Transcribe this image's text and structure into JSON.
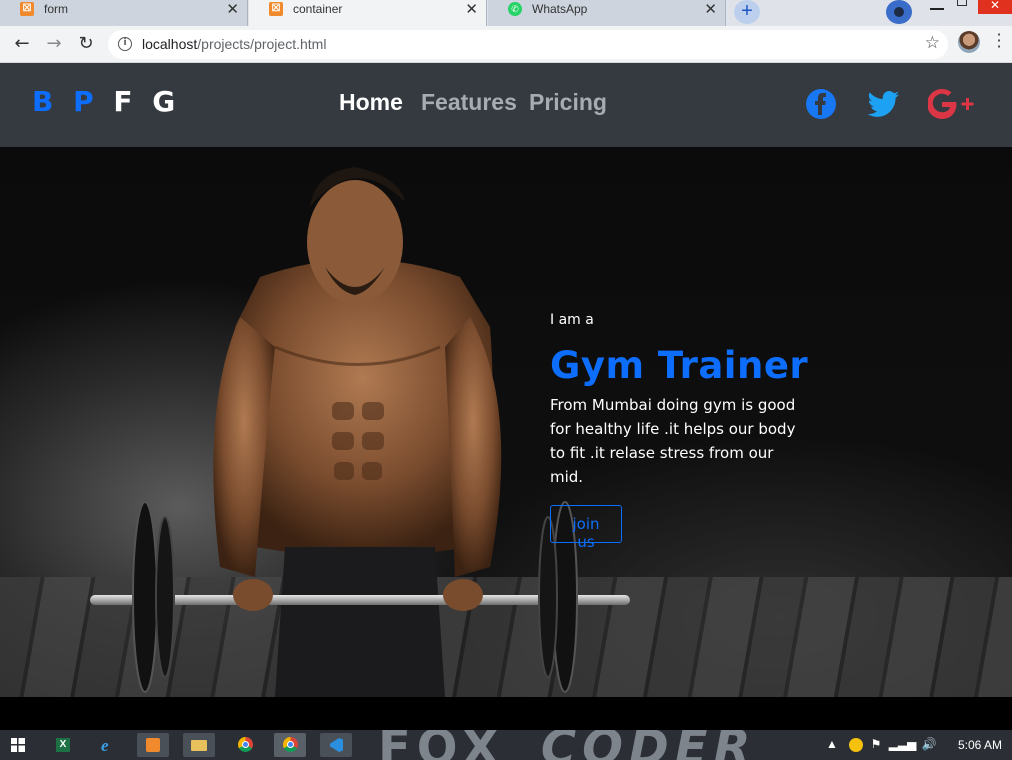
{
  "browser": {
    "tabs": [
      {
        "title": "form",
        "favicon": "xampp-icon",
        "active": false
      },
      {
        "title": "container",
        "favicon": "xampp-icon",
        "active": true
      },
      {
        "title": "WhatsApp",
        "favicon": "whatsapp-icon",
        "active": false
      }
    ],
    "close_glyph": "✕",
    "new_tab_glyph": "+",
    "url_host": "localhost",
    "url_path": "/projects/project.html"
  },
  "site": {
    "brand": [
      "B",
      "P",
      "F",
      "G"
    ],
    "brand_colors": [
      "#0d6efd",
      "#0d6efd",
      "#ffffff",
      "#ffffff"
    ],
    "nav": [
      {
        "label": "Home",
        "active": true
      },
      {
        "label": "Features",
        "active": false
      },
      {
        "label": "Pricing",
        "active": false
      }
    ],
    "social_icons": [
      "facebook-icon",
      "twitter-icon",
      "google-plus-icon"
    ],
    "colors": {
      "accent": "#0d6efd",
      "navbar": "#343a40",
      "facebook": "#1877f2",
      "twitter": "#1da1f2",
      "google": "#dc3545"
    }
  },
  "hero": {
    "intro": "I am a",
    "title": "Gym Trainer",
    "description": "From Mumbai doing gym is good for healthy life .it helps our body to fit .it relase stress from our mid.",
    "button": "join us"
  },
  "taskbar": {
    "watermark": [
      "FOX",
      "CODER"
    ],
    "clock": "5:06 AM",
    "pinned": [
      "windows-start-icon",
      "excel-icon",
      "internet-explorer-icon",
      "xampp-icon",
      "file-explorer-icon",
      "chrome-icon",
      "chrome-icon",
      "vscode-icon"
    ]
  }
}
